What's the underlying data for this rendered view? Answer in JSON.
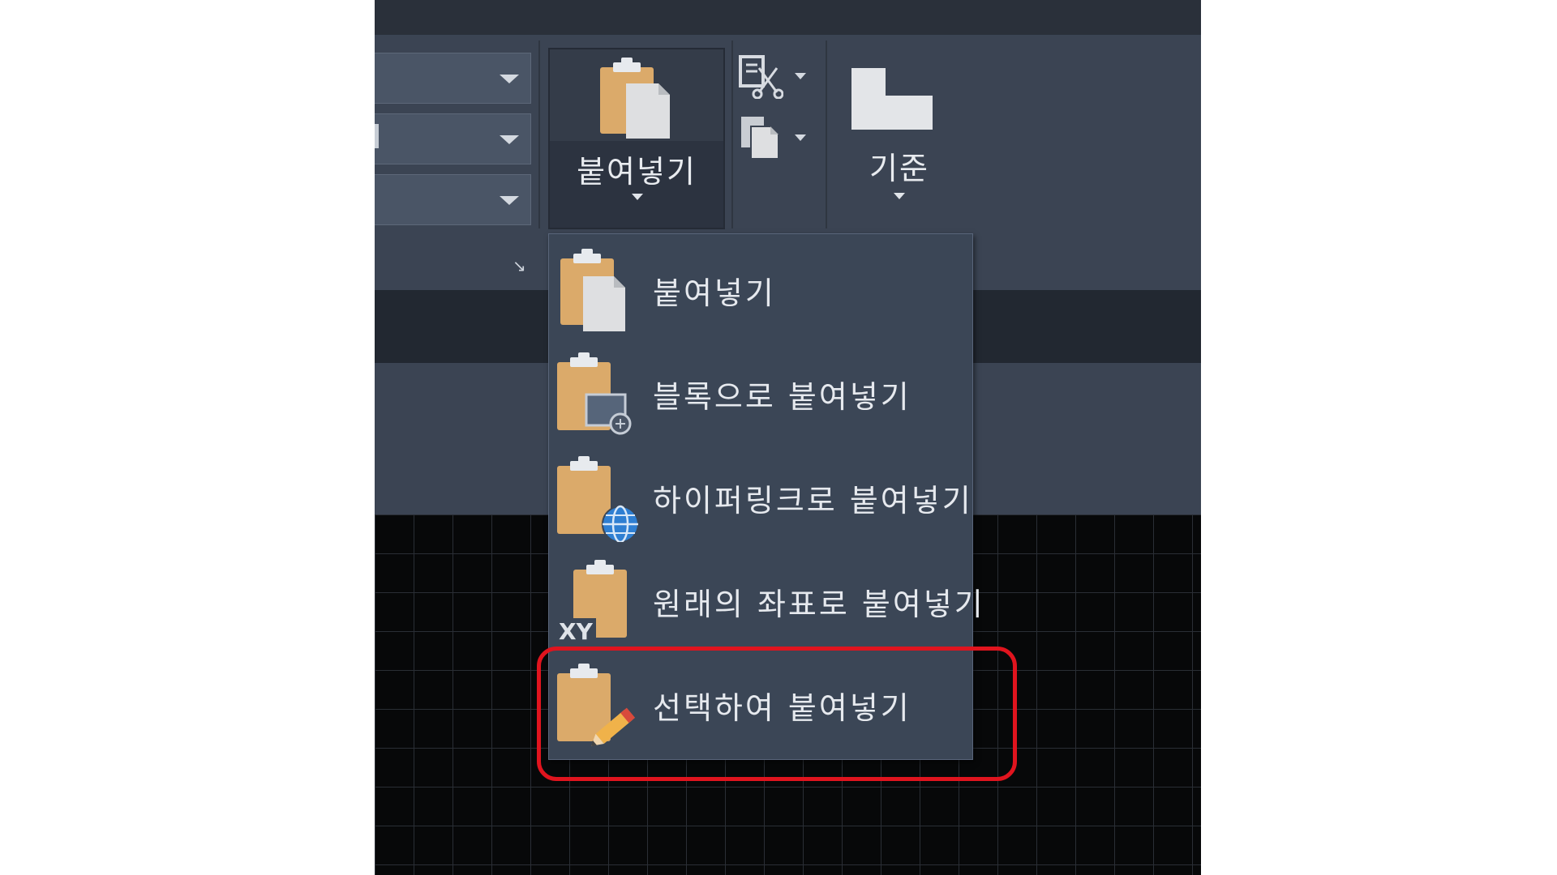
{
  "ribbon": {
    "paste_button_label": "붙여넣기",
    "base_button_label": "기준",
    "panel_launcher_glyph": "↘",
    "small_buttons": [
      {
        "icon": "cut-icon"
      },
      {
        "icon": "copy-icon"
      }
    ]
  },
  "paste_menu": {
    "items": [
      {
        "label": "붙여넣기",
        "icon": "paste-icon"
      },
      {
        "label": "블록으로 붙여넣기",
        "icon": "paste-as-block-icon"
      },
      {
        "label": "하이퍼링크로 붙여넣기",
        "icon": "paste-as-hyperlink-icon"
      },
      {
        "label": "원래의 좌표로 붙여넣기",
        "icon": "paste-original-coordinates-icon",
        "badge": "XY"
      },
      {
        "label": "선택하여 붙여넣기",
        "icon": "paste-special-icon",
        "highlighted": true
      }
    ]
  },
  "colors": {
    "ribbon_background": "#3b4453",
    "menu_background": "#3b4656",
    "clipboard": "#dbaa6a",
    "highlight_outline": "#e0141e",
    "canvas_background": "#070809"
  }
}
